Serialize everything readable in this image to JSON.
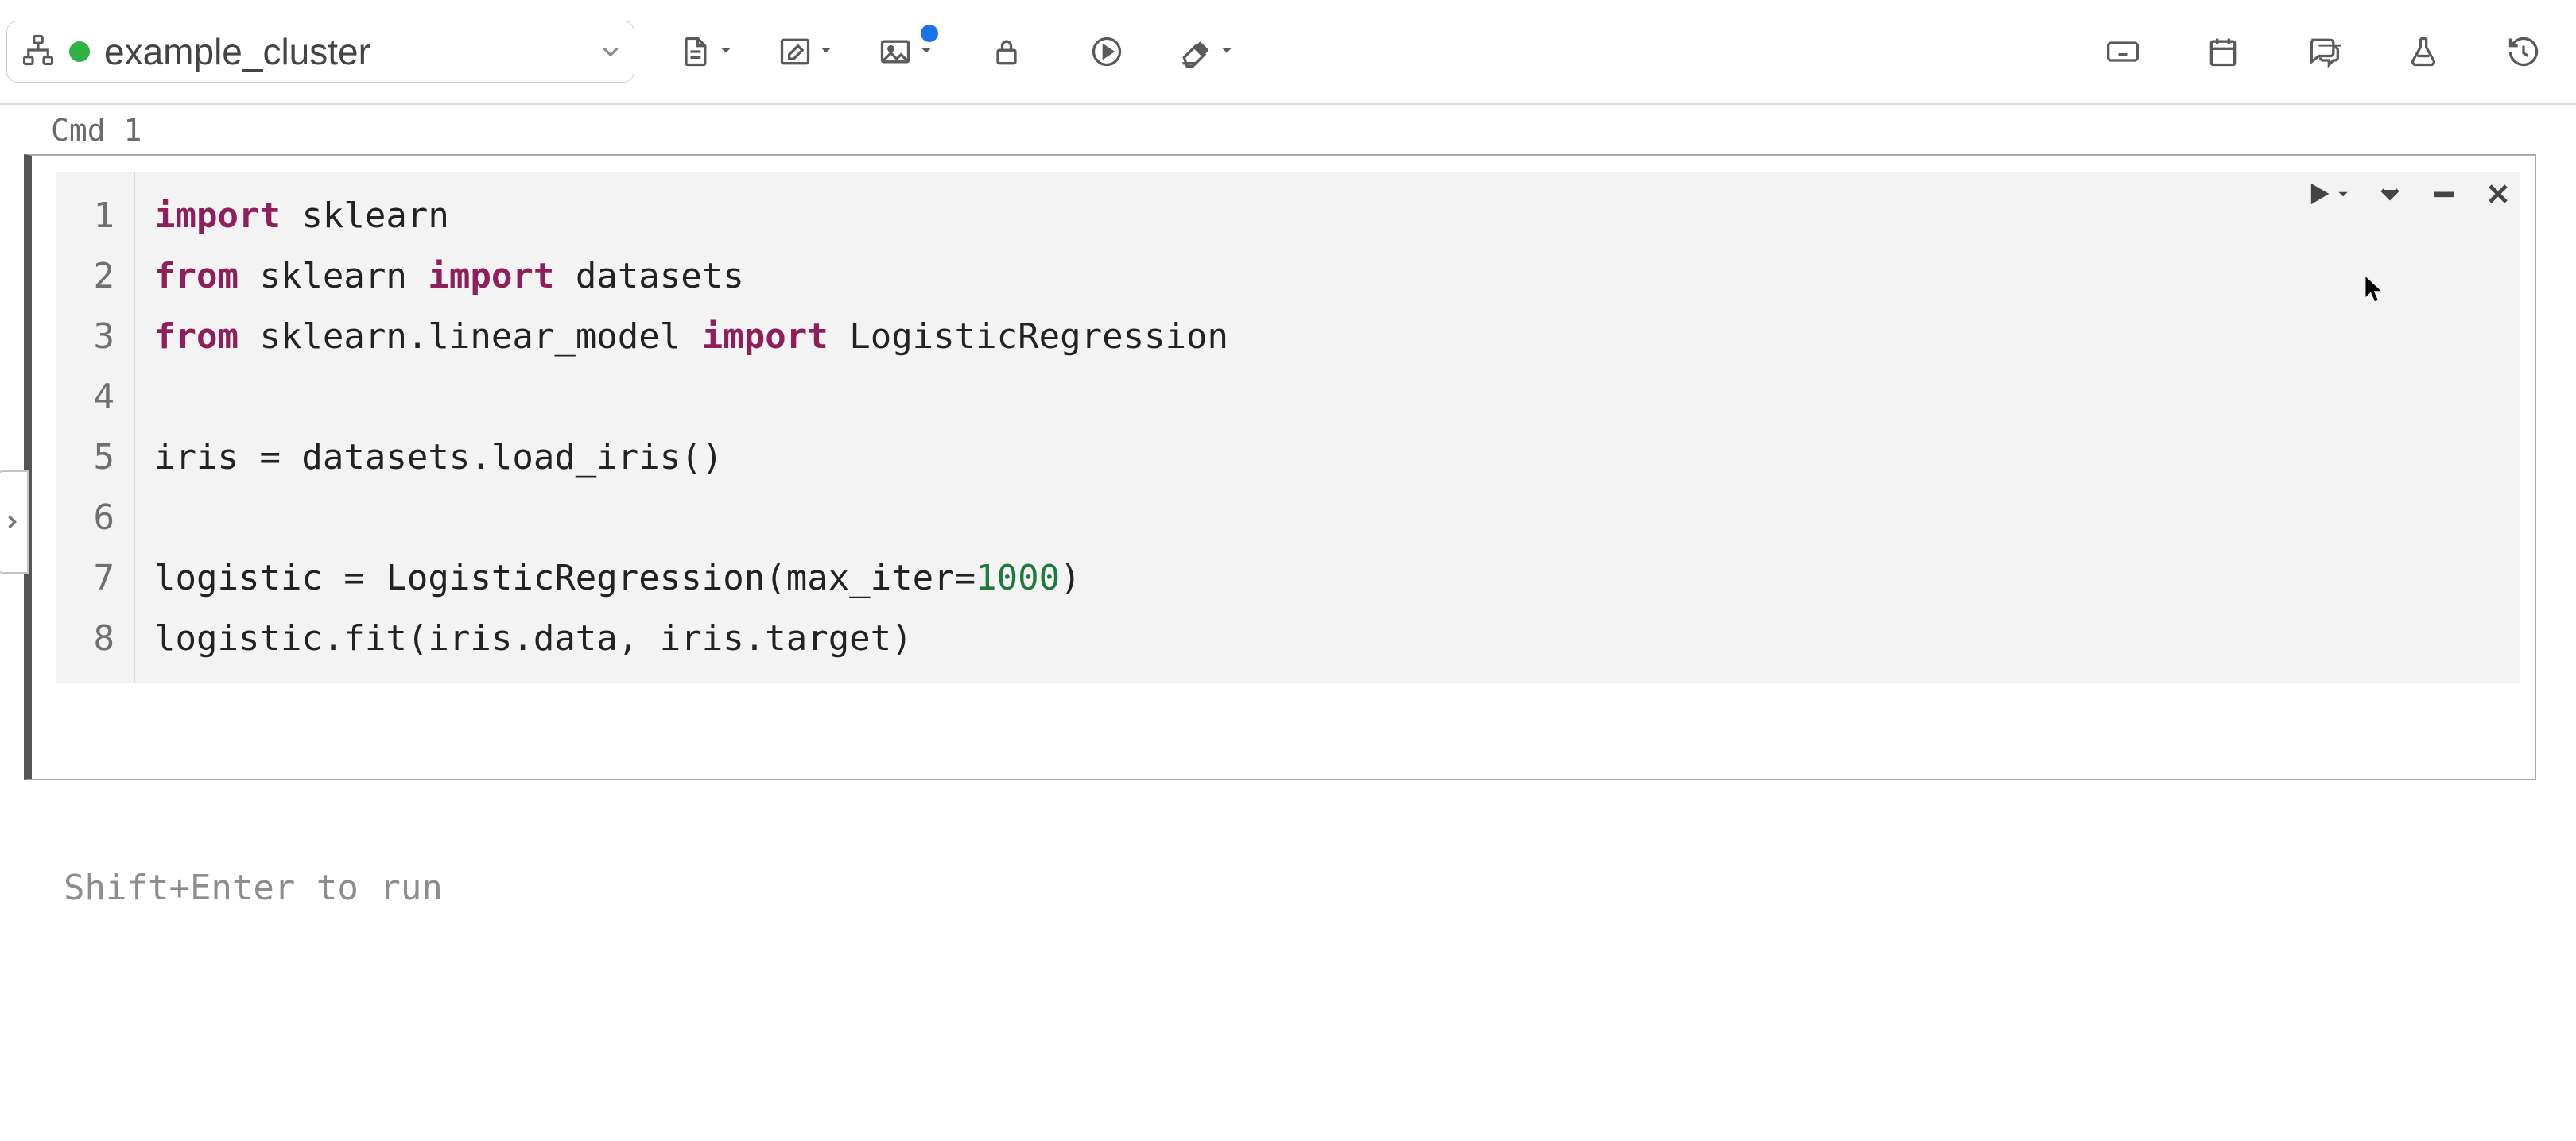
{
  "toolbar": {
    "cluster": {
      "name": "example_cluster",
      "status": "running",
      "status_color": "#2fb344"
    },
    "icons": {
      "tree": "hierarchy-icon",
      "chevron": "chevron-down-icon",
      "file": "file-icon",
      "edit": "edit-icon",
      "image": "image-icon",
      "lock": "lock-icon",
      "run_all": "play-circle-icon",
      "clear": "eraser-icon",
      "keyboard": "keyboard-icon",
      "schedule": "calendar-icon",
      "comments": "comments-icon",
      "experiments": "flask-icon",
      "revision": "history-icon"
    }
  },
  "cell": {
    "label": "Cmd 1",
    "gutter": [
      "1",
      "2",
      "3",
      "4",
      "5",
      "6",
      "7",
      "8"
    ],
    "code_lines": [
      [
        {
          "t": "import",
          "c": "kw"
        },
        {
          "t": " sklearn"
        }
      ],
      [
        {
          "t": "from",
          "c": "kw"
        },
        {
          "t": " sklearn "
        },
        {
          "t": "import",
          "c": "kw"
        },
        {
          "t": " datasets"
        }
      ],
      [
        {
          "t": "from",
          "c": "kw"
        },
        {
          "t": " sklearn.linear_model "
        },
        {
          "t": "import",
          "c": "kw"
        },
        {
          "t": " LogisticRegression"
        }
      ],
      [
        {
          "t": ""
        }
      ],
      [
        {
          "t": "iris = datasets.load_iris()"
        }
      ],
      [
        {
          "t": ""
        }
      ],
      [
        {
          "t": "logistic = LogisticRegression(max_iter="
        },
        {
          "t": "1000",
          "c": "num"
        },
        {
          "t": ")"
        }
      ],
      [
        {
          "t": "logistic.fit(iris.data, iris.target)"
        }
      ]
    ],
    "actions": {
      "run": "run-cell",
      "expand": "expand-below",
      "minimize": "minimize-cell",
      "delete": "delete-cell"
    }
  },
  "hint": "Shift+Enter to run"
}
